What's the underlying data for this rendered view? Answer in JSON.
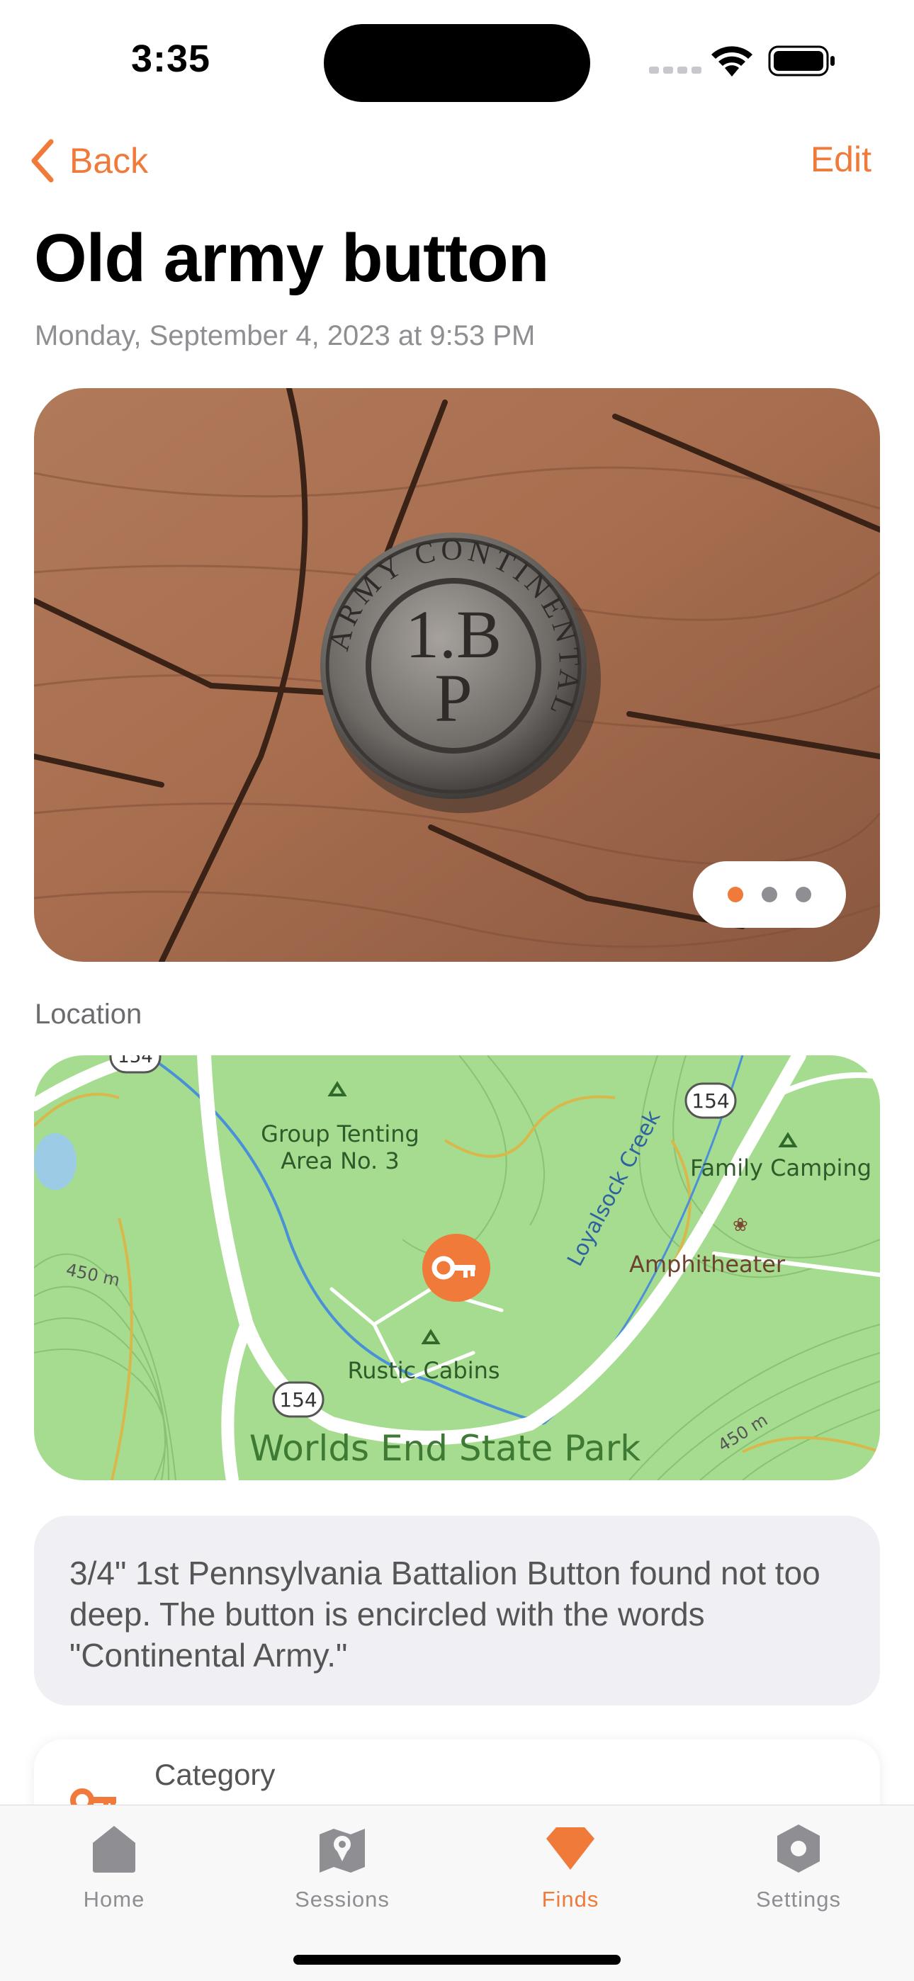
{
  "status_bar": {
    "time": "3:35"
  },
  "nav": {
    "back_label": "Back",
    "edit_label": "Edit"
  },
  "find": {
    "title": "Old army button",
    "date": "Monday, September 4, 2023 at 9:53 PM",
    "photo_pager": {
      "count": 3,
      "current": 1
    },
    "button_engraving": {
      "top_text": "ARMY CONTINENTAL",
      "center_line1": "1.B",
      "center_line2": "P"
    }
  },
  "location": {
    "section_label": "Location",
    "map_labels": {
      "route_badge": "154",
      "group_tenting_1": "Group Tenting",
      "group_tenting_2": "Area No. 3",
      "family_camping": "Family Camping",
      "amphitheater": "Amphitheater",
      "rustic_cabins": "Rustic Cabins",
      "creek": "Loyalsock Creek",
      "elevation_left": "450 m",
      "elevation_right": "450 m",
      "park": "Worlds End State Park"
    }
  },
  "notes": "3/4\" 1st Pennsylvania Battalion Button found not too deep. The button is encircled with the words \"Continental Army.\"",
  "details": {
    "category_label": "Category"
  },
  "tabs": [
    {
      "label": "Home",
      "icon": "home-icon"
    },
    {
      "label": "Sessions",
      "icon": "map-pin-icon"
    },
    {
      "label": "Finds",
      "icon": "diamond-icon",
      "active": true
    },
    {
      "label": "Settings",
      "icon": "gear-hex-icon"
    }
  ],
  "colors": {
    "accent": "#f07a3a",
    "map_green": "#a6dc8f",
    "road": "#ffffff",
    "notes_bg": "#efeff4"
  }
}
